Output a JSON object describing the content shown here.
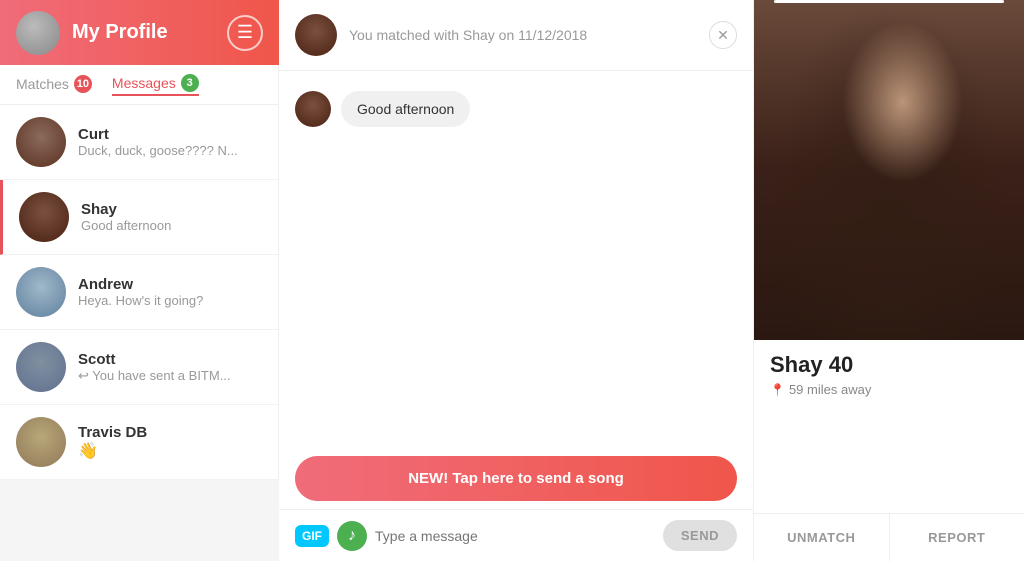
{
  "header": {
    "title": "My Profile",
    "icon": "☰"
  },
  "tabs": [
    {
      "id": "matches",
      "label": "Matches",
      "badge": "10",
      "active": false
    },
    {
      "id": "messages",
      "label": "Messages",
      "badge": "3",
      "active": true
    }
  ],
  "contacts": [
    {
      "id": "curt",
      "name": "Curt",
      "preview": "Duck, duck, goose???? N...",
      "active": false,
      "emoji": null
    },
    {
      "id": "shay",
      "name": "Shay",
      "preview": "Good afternoon",
      "active": true,
      "emoji": null
    },
    {
      "id": "andrew",
      "name": "Andrew",
      "preview": "Heya. How's it going?",
      "active": false,
      "emoji": null
    },
    {
      "id": "scott",
      "name": "Scott",
      "preview": "↩ You have sent a BITM...",
      "active": false,
      "emoji": null
    },
    {
      "id": "travis",
      "name": "Travis DB",
      "preview": null,
      "active": false,
      "emoji": "👋"
    }
  ],
  "chat": {
    "match_text": "You matched with Shay on 11/12/2018",
    "messages": [
      {
        "id": 1,
        "text": "Good afternoon",
        "mine": false
      }
    ],
    "song_banner": "NEW! Tap here to send a song",
    "input_placeholder": "Type a message",
    "send_label": "SEND",
    "gif_label": "GIF"
  },
  "profile": {
    "name": "Shay",
    "age": "40",
    "distance": "59 miles away",
    "unmatch_label": "UNMATCH",
    "report_label": "REPORT"
  }
}
